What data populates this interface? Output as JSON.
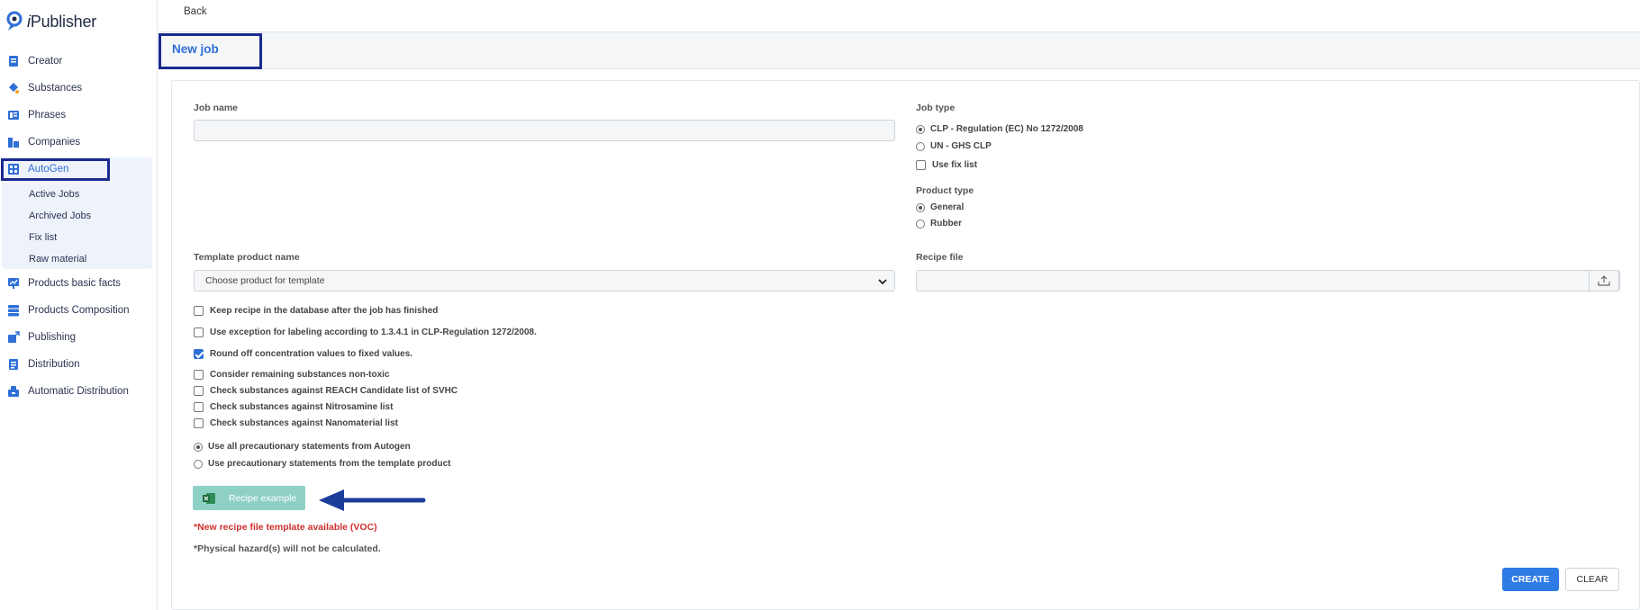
{
  "app": {
    "logo_prefix": "i",
    "logo_rest": "Publisher"
  },
  "sidebar": {
    "items": [
      {
        "label": "Creator",
        "icon": "creator-icon"
      },
      {
        "label": "Substances",
        "icon": "substances-icon"
      },
      {
        "label": "Phrases",
        "icon": "phrases-icon"
      },
      {
        "label": "Companies",
        "icon": "companies-icon"
      },
      {
        "label": "AutoGen",
        "icon": "autogen-icon",
        "active": true
      },
      {
        "label": "Products basic facts",
        "icon": "products-basic-facts-icon"
      },
      {
        "label": "Products Composition",
        "icon": "products-composition-icon"
      },
      {
        "label": "Publishing",
        "icon": "publishing-icon"
      },
      {
        "label": "Distribution",
        "icon": "distribution-icon"
      },
      {
        "label": "Automatic Distribution",
        "icon": "automatic-distribution-icon"
      }
    ],
    "sub_items": [
      "Active Jobs",
      "Archived Jobs",
      "Fix list",
      "Raw material"
    ]
  },
  "header": {
    "back_label": "Back",
    "page_title": "New job"
  },
  "form": {
    "job_name_label": "Job name",
    "job_name_value": "",
    "job_type_label": "Job type",
    "job_type_options": [
      "CLP - Regulation (EC) No 1272/2008",
      "UN - GHS CLP"
    ],
    "job_type_selected": "CLP - Regulation (EC) No 1272/2008",
    "use_fix_list_label": "Use fix list",
    "product_type_label": "Product type",
    "product_type_options": [
      "General",
      "Rubber"
    ],
    "product_type_selected": "General",
    "template_product_label": "Template product name",
    "template_product_placeholder": "Choose product for template",
    "recipe_file_label": "Recipe file",
    "checkboxes": [
      {
        "label": "Keep recipe in the database after the job has finished",
        "checked": false
      },
      {
        "label": "Use exception for labeling according to 1.3.4.1 in CLP-Regulation 1272/2008.",
        "checked": false
      },
      {
        "label": "Round off concentration values to fixed values.",
        "checked": true
      },
      {
        "label": "Consider remaining substances non-toxic",
        "checked": false
      },
      {
        "label": "Check substances against REACH Candidate list of SVHC",
        "checked": false
      },
      {
        "label": "Check substances against Nitrosamine list",
        "checked": false
      },
      {
        "label": "Check substances against Nanomaterial list",
        "checked": false
      }
    ],
    "precautionary_options": [
      {
        "label": "Use all precautionary statements from Autogen",
        "selected": true
      },
      {
        "label": "Use precautionary statements from the template product",
        "selected": false
      }
    ],
    "recipe_example_label": "Recipe example",
    "note_red": "*New recipe file template available (VOC)",
    "note": "*Physical hazard(s) will not be calculated.",
    "create_label": "CREATE",
    "clear_label": "CLEAR"
  },
  "colors": {
    "accent": "#2f6fd6",
    "highlight_box": "#1a2a8f",
    "recipe_button": "#8fd0c5",
    "warning_text": "#d12f2f"
  }
}
